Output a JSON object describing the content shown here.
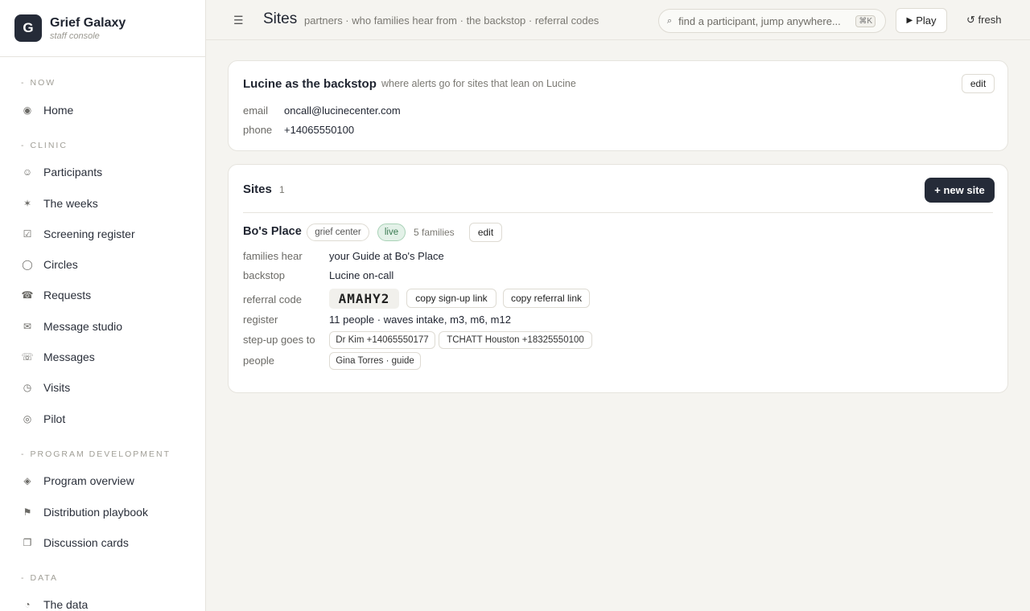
{
  "brand": {
    "logo_letter": "G",
    "name": "Grief Galaxy",
    "subtitle": "staff console"
  },
  "sidebar": {
    "sections": [
      {
        "label": "NOW"
      },
      {
        "label": "CLINIC"
      },
      {
        "label": "PROGRAM DEVELOPMENT"
      },
      {
        "label": "DATA"
      }
    ],
    "items": [
      {
        "label": "Home",
        "icon": "◉"
      },
      {
        "label": "Participants",
        "icon": "☺"
      },
      {
        "label": "The weeks",
        "icon": "✶"
      },
      {
        "label": "Screening register",
        "icon": "☑"
      },
      {
        "label": "Circles",
        "icon": "◯"
      },
      {
        "label": "Requests",
        "icon": "☎"
      },
      {
        "label": "Message studio",
        "icon": "✉"
      },
      {
        "label": "Messages",
        "icon": "☏"
      },
      {
        "label": "Visits",
        "icon": "◷"
      },
      {
        "label": "Pilot",
        "icon": "◎"
      },
      {
        "label": "Program overview",
        "icon": "◈"
      },
      {
        "label": "Distribution playbook",
        "icon": "⚑"
      },
      {
        "label": "Discussion cards",
        "icon": "❐"
      },
      {
        "label": "The data",
        "icon": "◔"
      }
    ]
  },
  "topbar": {
    "title": "Sites",
    "subtitle": "partners · who families hear from · the backstop · referral codes",
    "search_placeholder": "find a participant, jump anywhere...",
    "search_shortcut": "⌘K",
    "play_label": "Play",
    "fresh_label": "fresh"
  },
  "backstop": {
    "title": "Lucine as the backstop",
    "description": "where alerts go for sites that lean on Lucine",
    "edit_label": "edit",
    "email_label": "email",
    "email": "oncall@lucinecenter.com",
    "phone_label": "phone",
    "phone": "+14065550100"
  },
  "sites": {
    "title": "Sites",
    "count": "1",
    "new_label": "+ new site",
    "site": {
      "name": "Bo's Place",
      "type": "grief center",
      "status": "live",
      "families": "5 families",
      "edit_label": "edit",
      "families_hear_label": "families hear",
      "families_hear": "your Guide at Bo's Place",
      "backstop_label": "backstop",
      "backstop": "Lucine on-call",
      "referral_label": "referral code",
      "referral_code": "AMAHY2",
      "copy_signup": "copy sign-up link",
      "copy_referral": "copy referral link",
      "register_label": "register",
      "register": "11 people · waves intake, m3, m6, m12",
      "stepup_label": "step-up goes to",
      "stepup": [
        "Dr Kim +14065550177",
        "TCHATT Houston +18325550100"
      ],
      "people_label": "people",
      "people": [
        "Gina Torres · guide"
      ]
    }
  }
}
